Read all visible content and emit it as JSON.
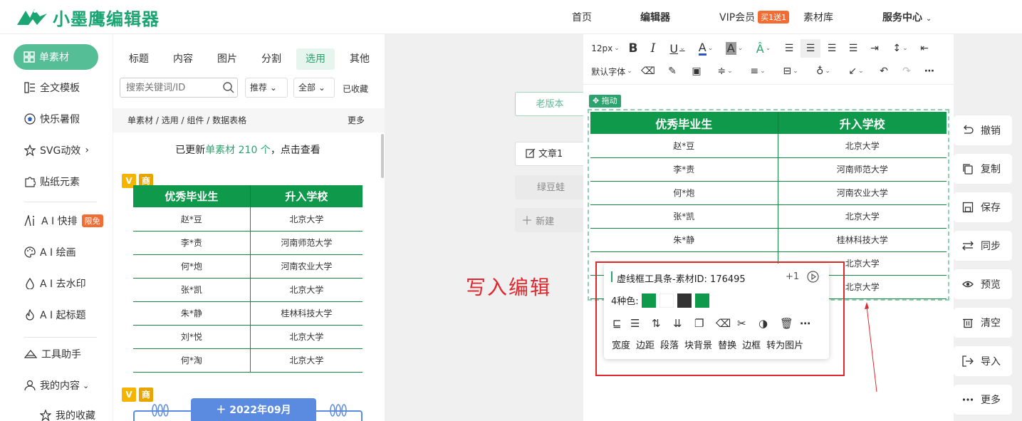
{
  "app": {
    "brand": "小墨鹰编辑器",
    "accent": "#2aa36f",
    "table_green": "#0e9a4a",
    "red_annotation": "#e0272d"
  },
  "nav": {
    "home": "首页",
    "editor": "编辑器",
    "vip": "VIP会员",
    "vip_badge": "买1送1",
    "materials": "素材库",
    "service": "服务中心"
  },
  "sidebar": {
    "items": [
      {
        "label": "单素材",
        "icon": "grid-icon"
      },
      {
        "label": "全文模板",
        "icon": "template-icon"
      },
      {
        "label": "快乐暑假",
        "icon": "soccer-ball-icon"
      },
      {
        "label": "SVG动效",
        "icon": "star-icon"
      },
      {
        "label": "贴纸元素",
        "icon": "puzzle-icon"
      },
      {
        "label": "A I 快排",
        "icon": "ai-icon",
        "badge": "限免"
      },
      {
        "label": "A I 绘画",
        "icon": "palette-icon"
      },
      {
        "label": "A I 去水印",
        "icon": "drop-icon"
      },
      {
        "label": "A I 起标题",
        "icon": "flame-icon"
      },
      {
        "label": "工具助手",
        "icon": "tool-icon"
      },
      {
        "label": "我的内容",
        "icon": "user-icon"
      },
      {
        "label": "我的收藏",
        "icon": "star-outline-icon"
      }
    ]
  },
  "material_panel": {
    "tabs": [
      "标题",
      "内容",
      "图片",
      "分割",
      "选用",
      "其他"
    ],
    "active_tab": "选用",
    "search_placeholder": "搜索关键词/ID",
    "sort": "推荐",
    "filter": "全部",
    "favorites": "已收藏",
    "breadcrumb": [
      "单素材",
      "选用",
      "组件",
      "数据表格"
    ],
    "more": "更多",
    "updated_prefix": "已更新",
    "updated_link": "单素材 210 个",
    "updated_suffix": "，点击查看",
    "vtag": "V",
    "commercial_tag": "商",
    "table": {
      "headers": [
        "优秀毕业生",
        "升入学校"
      ],
      "rows": [
        [
          "赵*豆",
          "北京大学"
        ],
        [
          "李*责",
          "河南师范大学"
        ],
        [
          "何*炮",
          "河南农业大学"
        ],
        [
          "张*凯",
          "北京大学"
        ],
        [
          "朱*静",
          "桂林科技大学"
        ],
        [
          "刘*悦",
          "北京大学"
        ],
        [
          "何*淘",
          "北京大学"
        ]
      ]
    },
    "calendar_label": "2022年09月"
  },
  "canvas": {
    "old_version": "老版本",
    "article": "文章1",
    "article2": "绿豆蛙",
    "new": "新建",
    "annotation": "写入编辑"
  },
  "editor": {
    "font_size": "12px",
    "font_family": "默认字体",
    "drag_label": "拖动",
    "table": {
      "headers": [
        "优秀毕业生",
        "升入学校"
      ],
      "rows": [
        [
          "赵*豆",
          "北京大学"
        ],
        [
          "李*责",
          "河南师范大学"
        ],
        [
          "何*炮",
          "河南农业大学"
        ],
        [
          "张*凯",
          "北京大学"
        ],
        [
          "朱*静",
          "桂林科技大学"
        ],
        [
          "",
          "北京大学"
        ],
        [
          "",
          "北京大学"
        ]
      ]
    }
  },
  "popup": {
    "title": "虚线框工具条-素材ID: 176495",
    "plus": "+1",
    "colors_label": "4种色:",
    "colors": [
      "#0e9a4a",
      "#ffffff",
      "#333333",
      "#0e9a4a"
    ],
    "actions": [
      "宽度",
      "边距",
      "段落",
      "块背景",
      "替换",
      "边框",
      "转为图片"
    ]
  },
  "right_actions": [
    "撤销",
    "复制",
    "保存",
    "同步",
    "预览",
    "清空",
    "导入",
    "更多"
  ]
}
